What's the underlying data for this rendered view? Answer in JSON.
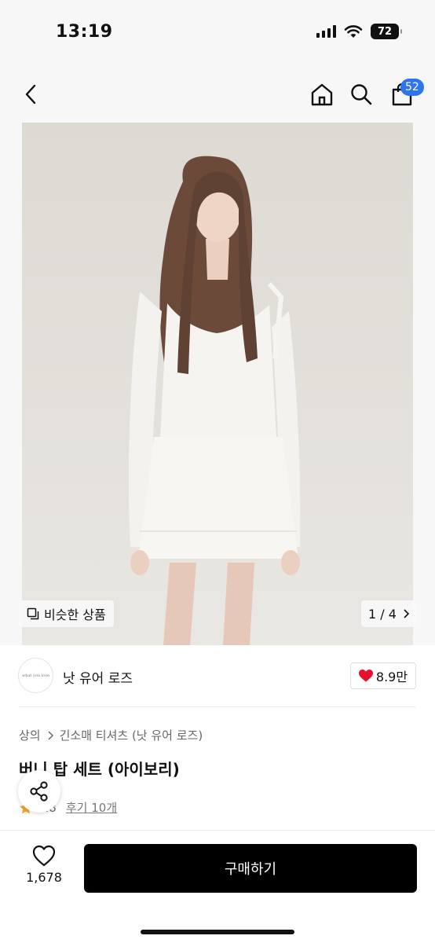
{
  "status_bar": {
    "time": "13:19",
    "battery": "72"
  },
  "header": {
    "cart_count": "52"
  },
  "gallery": {
    "similar_label": "비슷한 상품",
    "counter": "1 / 4"
  },
  "brand": {
    "logo_text": "what you love",
    "name": "낫 유어 로즈",
    "likes": "8.9만"
  },
  "breadcrumb": {
    "category": "상의",
    "subcategory": "긴소매 티셔츠 (낫 유어 로즈)"
  },
  "product": {
    "title": "버니 탑 세트 (아이보리)",
    "rating": "4.8",
    "reviews": "후기 10개"
  },
  "bottom_bar": {
    "wish_count": "1,678",
    "buy_label": "구매하기"
  },
  "colors": {
    "accent_badge": "#2e74f0",
    "heart": "#e8112d",
    "star": "#f5a623",
    "buy_button": "#000000"
  }
}
